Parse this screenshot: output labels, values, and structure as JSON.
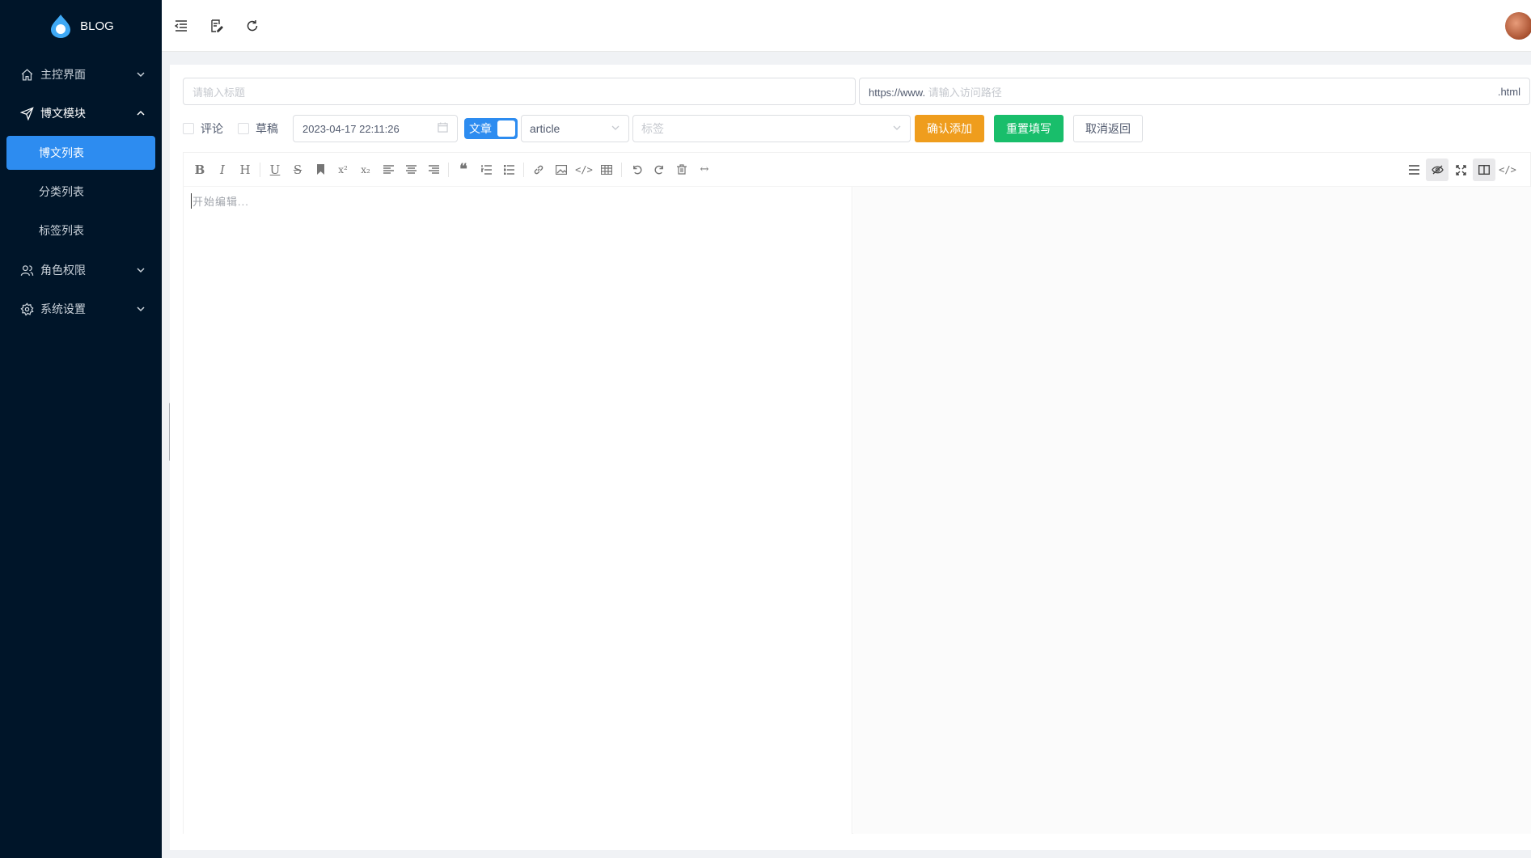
{
  "app": {
    "logo_text": "BLOG"
  },
  "sidebar": {
    "items": [
      {
        "label": "主控界面",
        "icon": "home-icon",
        "expanded": false
      },
      {
        "label": "博文模块",
        "icon": "send-icon",
        "expanded": true,
        "children": [
          "博文列表",
          "分类列表",
          "标签列表"
        ],
        "active_child": "博文列表"
      },
      {
        "label": "角色权限",
        "icon": "users-icon",
        "expanded": false
      },
      {
        "label": "系统设置",
        "icon": "gear-icon",
        "expanded": false
      }
    ]
  },
  "topbar": {
    "icons": [
      "collapse-menu-icon",
      "edit-note-icon",
      "refresh-icon"
    ],
    "avatar": "user-avatar"
  },
  "form": {
    "title_placeholder": "请输入标题",
    "url_prefix": "https://www.",
    "url_placeholder": "请输入访问路径",
    "url_suffix": ".html",
    "comment_label": "评论",
    "draft_label": "草稿",
    "datetime_value": "2023-04-17 22:11:26",
    "type_toggle_label": "文章",
    "category_value": "article",
    "tags_placeholder": "标签",
    "confirm_button": "确认添加",
    "reset_button": "重置填写",
    "cancel_button": "取消返回"
  },
  "editor": {
    "placeholder": "开始编辑...",
    "toolbar_left": [
      "bold",
      "italic",
      "heading",
      "underline",
      "strikethrough",
      "bookmark",
      "superscript",
      "subscript",
      "align-left",
      "align-center",
      "align-right",
      "quote",
      "ordered-list",
      "unordered-list",
      "link",
      "image",
      "code",
      "table",
      "undo",
      "redo",
      "trash",
      "html-toggle"
    ],
    "toolbar_right": [
      "navigation",
      "preview",
      "fullscreen",
      "subfield",
      "html-code"
    ],
    "colors": {
      "sidebar_bg": "#001529",
      "accent": "#2d8cf0",
      "confirm": "#ef9d1d",
      "reset": "#19be6b"
    }
  }
}
